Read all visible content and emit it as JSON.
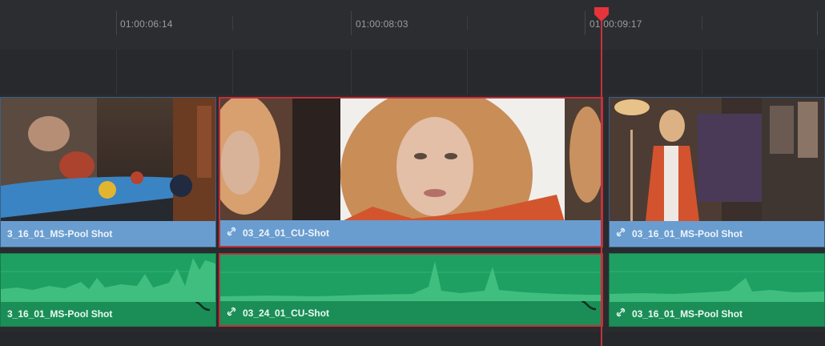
{
  "ruler": {
    "timecodes": [
      "01:00:06:14",
      "01:00:08:03",
      "01:00:09:17"
    ]
  },
  "video_clips": [
    {
      "name": "03_16_01_MS-Pool Shot",
      "label": "3_16_01_MS-Pool Shot",
      "linked": false,
      "selected": false
    },
    {
      "name": "03_24_01_CU-Shot",
      "label": "03_24_01_CU-Shot",
      "linked": true,
      "selected": true
    },
    {
      "name": "03_16_01_MS-Pool Shot",
      "label": "03_16_01_MS-Pool Shot",
      "linked": true,
      "selected": false
    }
  ],
  "audio_clips": [
    {
      "label": "3_16_01_MS-Pool Shot",
      "linked": false,
      "selected": false
    },
    {
      "label": "03_24_01_CU-Shot",
      "linked": true,
      "selected": true
    },
    {
      "label": "03_16_01_MS-Pool Shot",
      "linked": true,
      "selected": false
    }
  ],
  "icons": {
    "link": "link-icon",
    "fade": "audio-fade-icon",
    "playhead": "playhead-marker-icon"
  },
  "colors": {
    "video_clip": "#6a9dcf",
    "audio_clip": "#1ea063",
    "selection": "#c0303a",
    "playhead": "#c5323b",
    "background": "#2a2b2f"
  }
}
